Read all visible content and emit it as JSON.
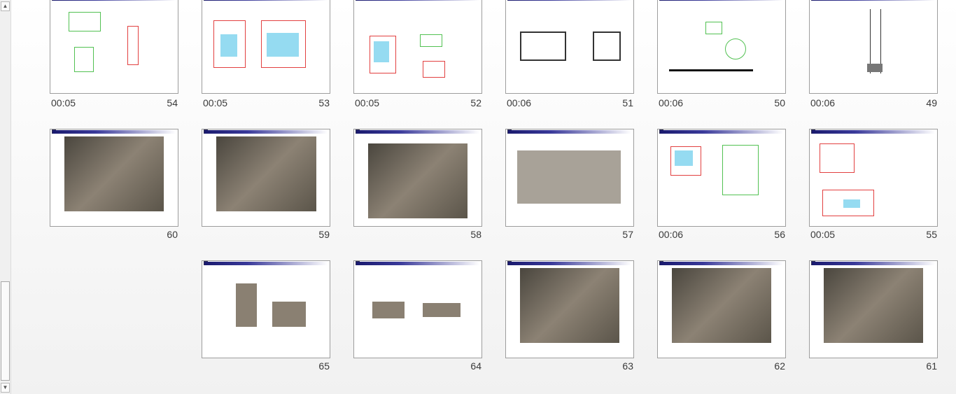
{
  "slides": [
    {
      "number": "54",
      "timing": "00:05"
    },
    {
      "number": "53",
      "timing": "00:05"
    },
    {
      "number": "52",
      "timing": "00:05"
    },
    {
      "number": "51",
      "timing": "00:06"
    },
    {
      "number": "50",
      "timing": "00:06"
    },
    {
      "number": "49",
      "timing": "00:06"
    },
    {
      "number": "60",
      "timing": ""
    },
    {
      "number": "59",
      "timing": ""
    },
    {
      "number": "58",
      "timing": ""
    },
    {
      "number": "57",
      "timing": ""
    },
    {
      "number": "56",
      "timing": "00:06"
    },
    {
      "number": "55",
      "timing": "00:05"
    },
    {
      "number": "65",
      "timing": ""
    },
    {
      "number": "64",
      "timing": ""
    },
    {
      "number": "63",
      "timing": ""
    },
    {
      "number": "62",
      "timing": ""
    },
    {
      "number": "61",
      "timing": ""
    }
  ],
  "scrollbar": {
    "up_arrow": "▲",
    "down_arrow": "▼"
  }
}
